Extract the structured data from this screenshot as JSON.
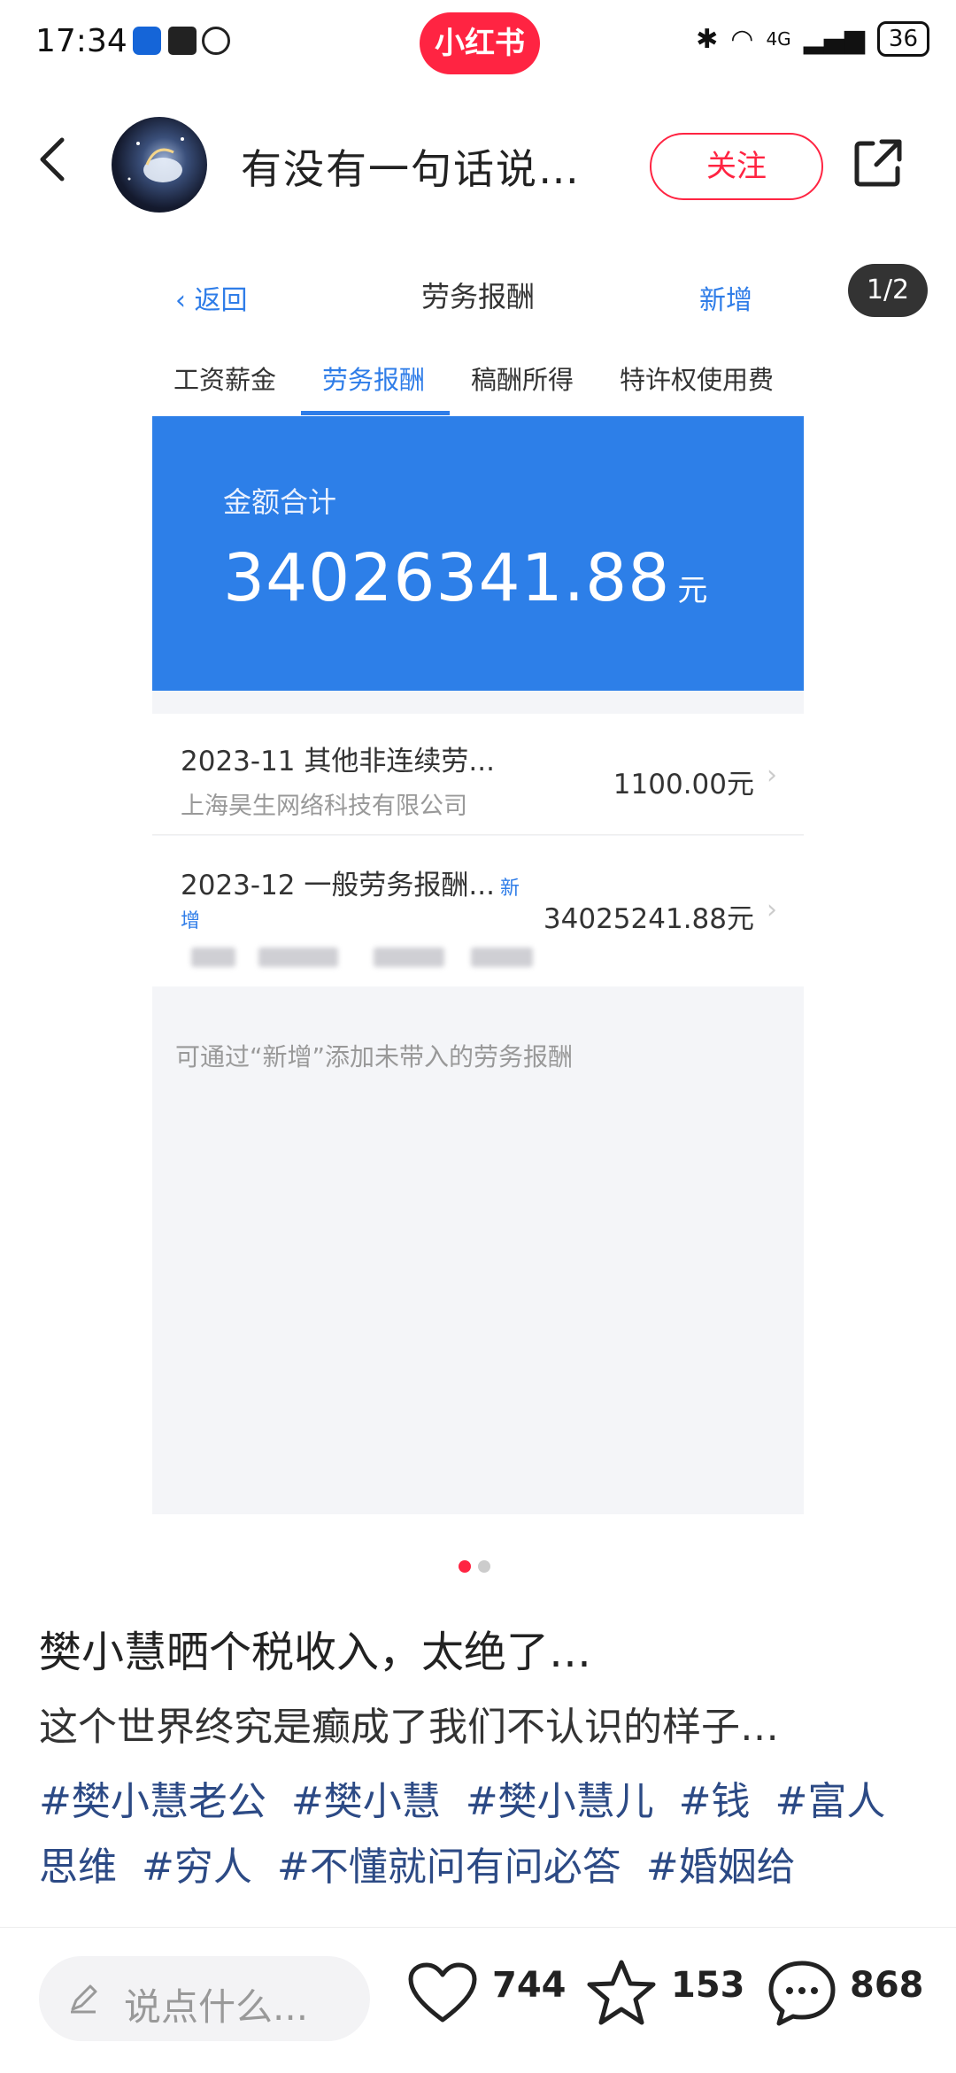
{
  "status_bar": {
    "time": "17:34",
    "signal": "4G",
    "battery": "36"
  },
  "brand": "小红书",
  "header": {
    "author": "有没有一句话说…",
    "follow": "关注"
  },
  "image": {
    "nav": {
      "back": "返回",
      "title": "劳务报酬",
      "new": "新增"
    },
    "tabs": [
      "工资薪金",
      "劳务报酬",
      "稿酬所得",
      "特许权使用费"
    ],
    "total_label": "金额合计",
    "total_amount": "34026341.88",
    "total_unit": "元",
    "records": [
      {
        "title": "2023-11 其他非连续劳...",
        "company": "上海昊生网络科技有限公司",
        "amount": "1100.00元"
      },
      {
        "title": "2023-12 一般劳务报酬...",
        "tag_a": "新",
        "tag_b": "增",
        "amount": "34025241.88元"
      }
    ],
    "hint": "可通过“新增”添加未带入的劳务报酬"
  },
  "pager": "1/2",
  "post": {
    "title": "樊小慧晒个税收入，太绝了…",
    "desc": "这个世界终究是癫成了我们不认识的样子…",
    "tags": [
      "#樊小慧老公",
      "#樊小慧",
      "#樊小慧儿",
      "#钱",
      "#富人思维",
      "#穷人",
      "#不懂就问有问必答",
      "#婚姻给"
    ]
  },
  "bottom": {
    "comment_placeholder": "说点什么...",
    "likes": "744",
    "stars": "153",
    "comments": "868"
  },
  "colors": {
    "brand": "#ff2442",
    "accent": "#2f7de8",
    "tag": "#2c4a85"
  }
}
